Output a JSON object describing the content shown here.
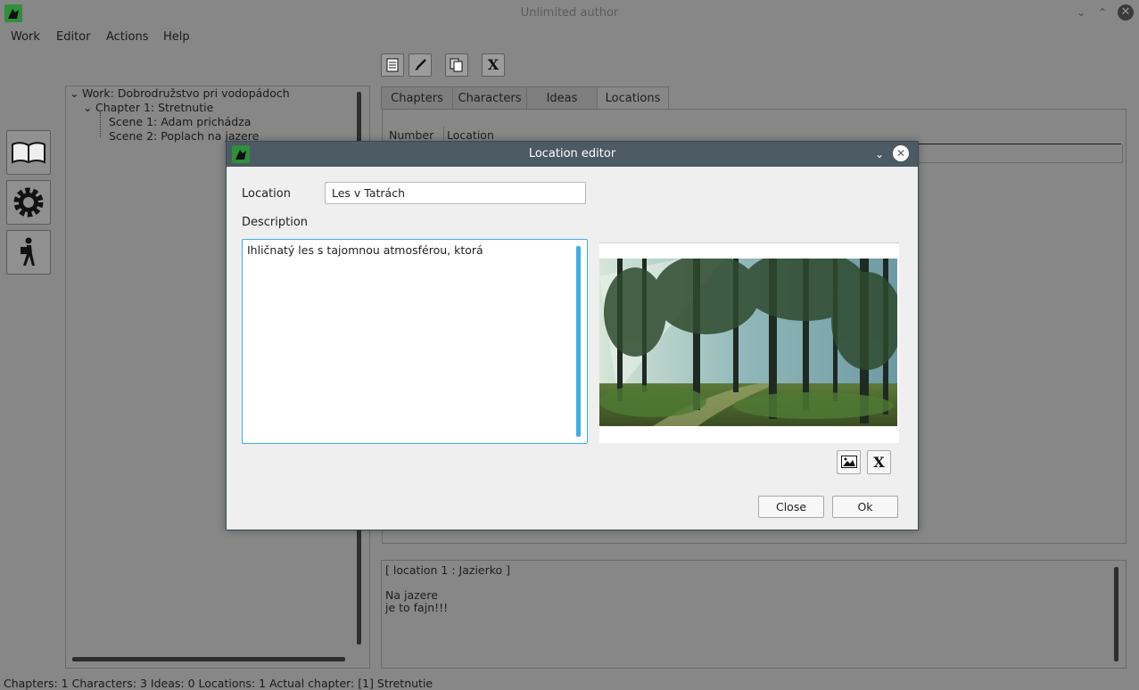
{
  "window": {
    "title": "Unlimited author",
    "minimize_glyph": "⌄",
    "maximize_glyph": "⌃",
    "close_glyph": "✕"
  },
  "menu": [
    "Work",
    "Editor",
    "Actions",
    "Help"
  ],
  "toolbar": {
    "icons": [
      "document-icon",
      "brush-icon",
      "copy-icon",
      "clear-icon"
    ],
    "x_glyph": "X"
  },
  "sidebar_buttons": [
    "book-icon",
    "gear-icon",
    "walker-icon"
  ],
  "tree": {
    "work": "Work: Dobrodružstvo pri vodopádoch",
    "chapter": "Chapter 1: Stretnutie",
    "scenes": [
      "Scene 1: Adam prichádza",
      "Scene 2: Poplach na jazere"
    ]
  },
  "tabs": [
    "Chapters",
    "Characters",
    "Ideas",
    "Locations"
  ],
  "active_tab": "Locations",
  "table": {
    "columns": [
      "Number",
      "Location"
    ]
  },
  "preview": {
    "header": "[ location 1 : Jazierko ]",
    "lines": [
      "Na jazere",
      "je to fajn!!!"
    ]
  },
  "status": "Chapters: 1  Characters: 3  Ideas: 0  Locations: 1  Actual chapter:  [1] Stretnutie",
  "dialog": {
    "title": "Location editor",
    "location_label": "Location",
    "location_value": "Les v Tatrách",
    "description_label": "Description",
    "description_value": "Ihličnatý les s tajomnou atmosférou, ktorá",
    "clear_glyph": "X",
    "close_label": "Close",
    "ok_label": "Ok"
  },
  "colors": {
    "accent": "#3daee9",
    "dialog_titlebar": "#4b5a63",
    "background": "#878787"
  }
}
